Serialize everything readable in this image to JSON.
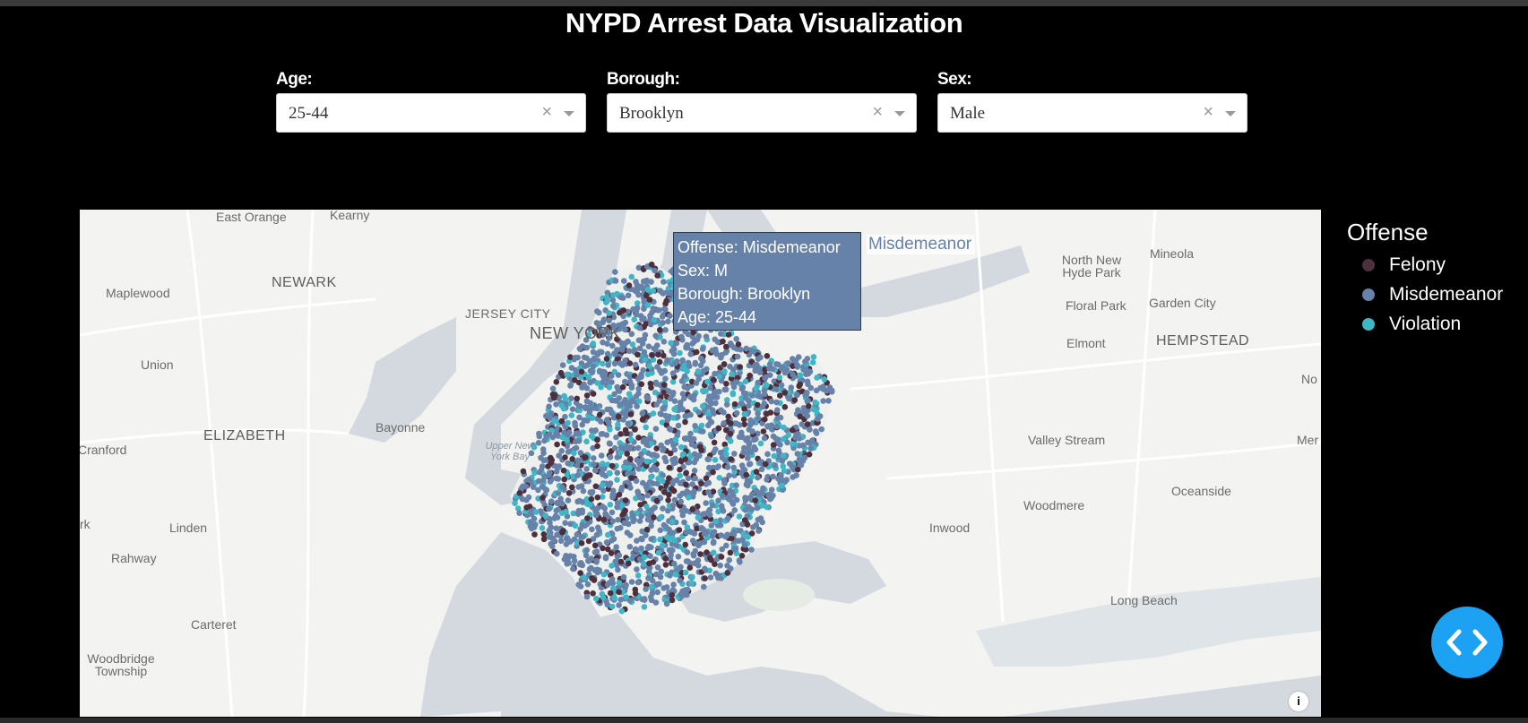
{
  "page": {
    "title": "NYPD Arrest Data Visualization"
  },
  "filters": [
    {
      "label": "Age:",
      "value": "25-44"
    },
    {
      "label": "Borough:",
      "value": "Brooklyn"
    },
    {
      "label": "Sex:",
      "value": "Male"
    }
  ],
  "clear_glyph": "×",
  "map": {
    "labels": {
      "east_orange": "East Orange",
      "kearny": "Kearny",
      "maplewood": "Maplewood",
      "newark": "NEWARK",
      "jersey_city": "JERSEY CITY",
      "new_york": "NEW YORK",
      "union": "Union",
      "elizabeth": "ELIZABETH",
      "bayonne": "Bayonne",
      "cranford": "Cranford",
      "upper_ny_bay": "Upper New York Bay",
      "linden": "Linden",
      "rahway": "Rahway",
      "carteret": "Carteret",
      "woodbridge": "Woodbridge Township",
      "north_new_hyde_park": "North New Hyde Park",
      "mineola": "Mineola",
      "floral_park": "Floral Park",
      "garden_city": "Garden City",
      "elmont": "Elmont",
      "hempstead": "HEMPSTEAD",
      "no": "No",
      "valley_stream": "Valley Stream",
      "mer": "Mer",
      "oceanside": "Oceanside",
      "woodmere": "Woodmere",
      "inwood": "Inwood",
      "long_beach": "Long Beach",
      "rk": "rk"
    },
    "info_glyph": "i",
    "tooltip": {
      "offense": "Offense: Misdemeanor",
      "sex": "Sex: M",
      "borough": "Borough: Brooklyn",
      "age": "Age: 25-44",
      "series_name": "Misdemeanor"
    }
  },
  "legend": {
    "title": "Offense",
    "items": [
      {
        "label": "Felony",
        "color": "#4d2f3d"
      },
      {
        "label": "Misdemeanor",
        "color": "#6782a8"
      },
      {
        "label": "Violation",
        "color": "#3fb6c6"
      }
    ]
  },
  "colors": {
    "background": "#000000",
    "map_land": "#f3f3f1",
    "map_water": "#d3d9de",
    "fab": "#1da1f2"
  },
  "fab": {
    "icon": "code-icon"
  }
}
